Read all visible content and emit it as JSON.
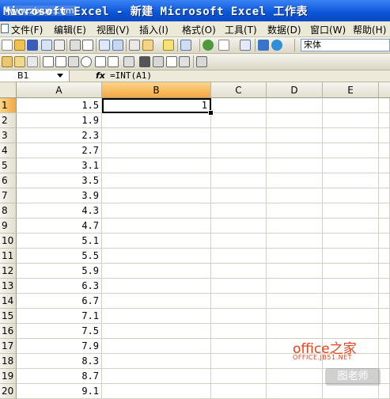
{
  "window": {
    "title": "Microsoft Excel - 新建 Microsoft Excel 工作表",
    "watermark": "www.zixue.com"
  },
  "menu": [
    {
      "label": "文件(F)"
    },
    {
      "label": "编辑(E)"
    },
    {
      "label": "视图(V)"
    },
    {
      "label": "插入(I)"
    },
    {
      "label": "格式(O)"
    },
    {
      "label": "工具(T)"
    },
    {
      "label": "数据(D)"
    },
    {
      "label": "窗口(W)"
    },
    {
      "label": "帮助(H)"
    }
  ],
  "toolbar": {
    "font_name": "宋体"
  },
  "formula_bar": {
    "name_box": "B1",
    "fx_label": "fx",
    "formula": "=INT(A1)"
  },
  "sheet": {
    "columns": [
      "A",
      "B",
      "C",
      "D",
      "E"
    ],
    "selected_column": "B",
    "rows": [
      {
        "n": "1",
        "a": "1.5",
        "b": "1"
      },
      {
        "n": "2",
        "a": "1.9",
        "b": ""
      },
      {
        "n": "3",
        "a": "2.3",
        "b": ""
      },
      {
        "n": "4",
        "a": "2.7",
        "b": ""
      },
      {
        "n": "5",
        "a": "3.1",
        "b": ""
      },
      {
        "n": "6",
        "a": "3.5",
        "b": ""
      },
      {
        "n": "7",
        "a": "3.9",
        "b": ""
      },
      {
        "n": "8",
        "a": "4.3",
        "b": ""
      },
      {
        "n": "9",
        "a": "4.7",
        "b": ""
      },
      {
        "n": "10",
        "a": "5.1",
        "b": ""
      },
      {
        "n": "11",
        "a": "5.5",
        "b": ""
      },
      {
        "n": "12",
        "a": "5.9",
        "b": ""
      },
      {
        "n": "13",
        "a": "6.3",
        "b": ""
      },
      {
        "n": "14",
        "a": "6.7",
        "b": ""
      },
      {
        "n": "15",
        "a": "7.1",
        "b": ""
      },
      {
        "n": "16",
        "a": "7.5",
        "b": ""
      },
      {
        "n": "17",
        "a": "7.9",
        "b": ""
      },
      {
        "n": "18",
        "a": "8.3",
        "b": ""
      },
      {
        "n": "19",
        "a": "8.7",
        "b": ""
      },
      {
        "n": "20",
        "a": "9.1",
        "b": ""
      }
    ]
  },
  "watermarks": {
    "site": "office之家",
    "site_url": "OFFICE.JB51.NET",
    "logo": "图老师"
  }
}
